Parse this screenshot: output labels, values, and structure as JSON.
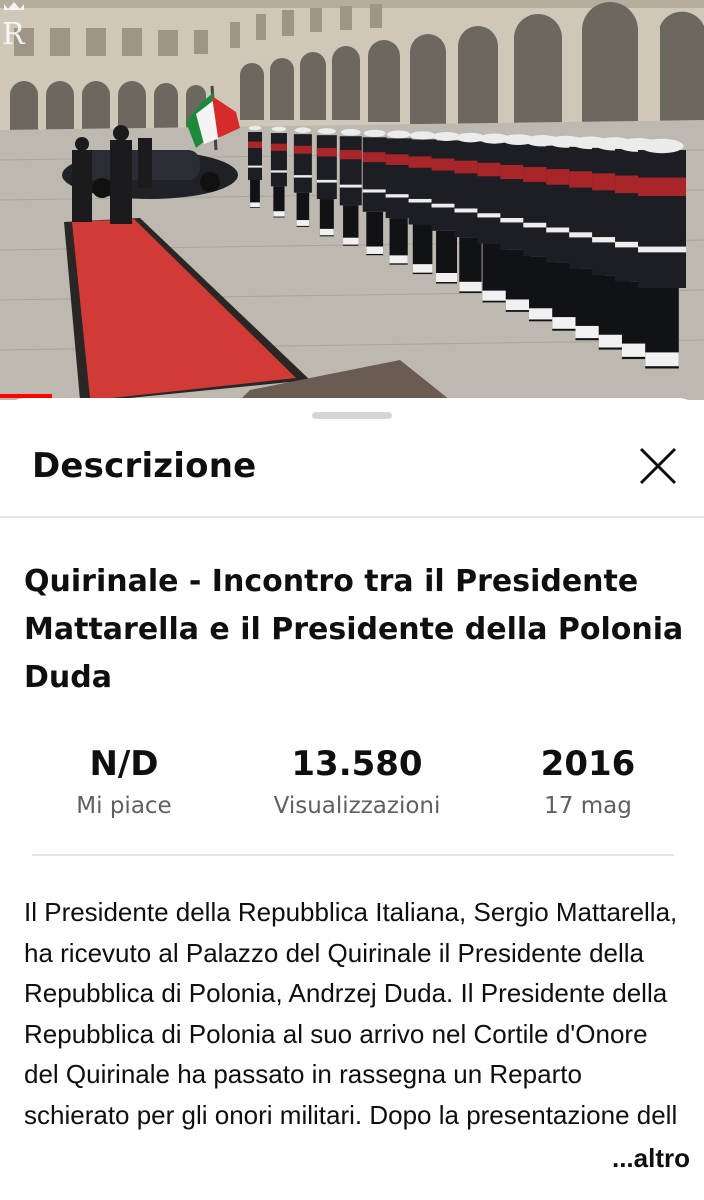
{
  "video": {
    "watermark_letters": "R",
    "progress_fraction": 0.074
  },
  "sheet": {
    "header_title": "Descrizione",
    "close_icon": "close-icon"
  },
  "video_info": {
    "title": "Quirinale - Incontro tra il Presidente Mattarella e il Presidente della Polonia Duda",
    "stats": {
      "likes_value": "N/D",
      "likes_label": "Mi piace",
      "views_value": "13.580",
      "views_label": "Visualizzazioni",
      "year_value": "2016",
      "date_label": "17 mag"
    },
    "description": "Il Presidente della Repubblica Italiana, Sergio Mattarella, ha ricevuto al Palazzo del Quirinale il Presidente della Repubblica di Polonia, Andrzej Duda. Il Presidente della Repubblica di Polonia al suo arrivo nel Cortile d'Onore del Quirinale ha passato in rassegna un Reparto schierato per gli onori militari. Dopo la presentazione dell",
    "more_label": "...altro"
  },
  "colors": {
    "accent": "#ff0000",
    "text_primary": "#0f0f0f",
    "text_secondary": "#606060"
  }
}
